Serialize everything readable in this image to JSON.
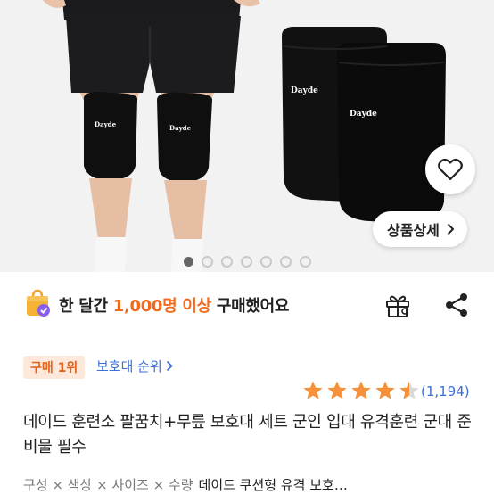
{
  "hero": {
    "brand_left_1": "Dayde",
    "brand_left_2": "Dayde",
    "brand_right_1": "Dayde",
    "brand_right_2": "Dayde",
    "detail_button_label": "상품상세",
    "carousel": {
      "total": 7,
      "active_index": 0
    }
  },
  "purchase": {
    "prefix": "한 달간 ",
    "count": "1,000명 이상",
    "suffix": " 구매했어요"
  },
  "rank": {
    "badge": "구매 1위",
    "category_link": "보호대 순위"
  },
  "rating": {
    "stars": 4.5,
    "review_count": "(1,194)"
  },
  "product": {
    "title": "데이드 훈련소 팔꿈치+무릎 보호대 세트 군인 입대 유격훈련 군대 준비물 필수"
  },
  "options": {
    "summary": "구성 × 색상 × 사이즈 × 수량",
    "product_name": "데이드 쿠션형 유격 보호…"
  },
  "colors": {
    "accent_orange": "#f26b1d",
    "link_blue": "#3b6fd6",
    "star_orange": "#f5913a"
  },
  "icons": [
    "heart-icon",
    "chevron-right-icon",
    "shopping-bag-icon",
    "gift-icon",
    "share-icon",
    "star-icon"
  ]
}
